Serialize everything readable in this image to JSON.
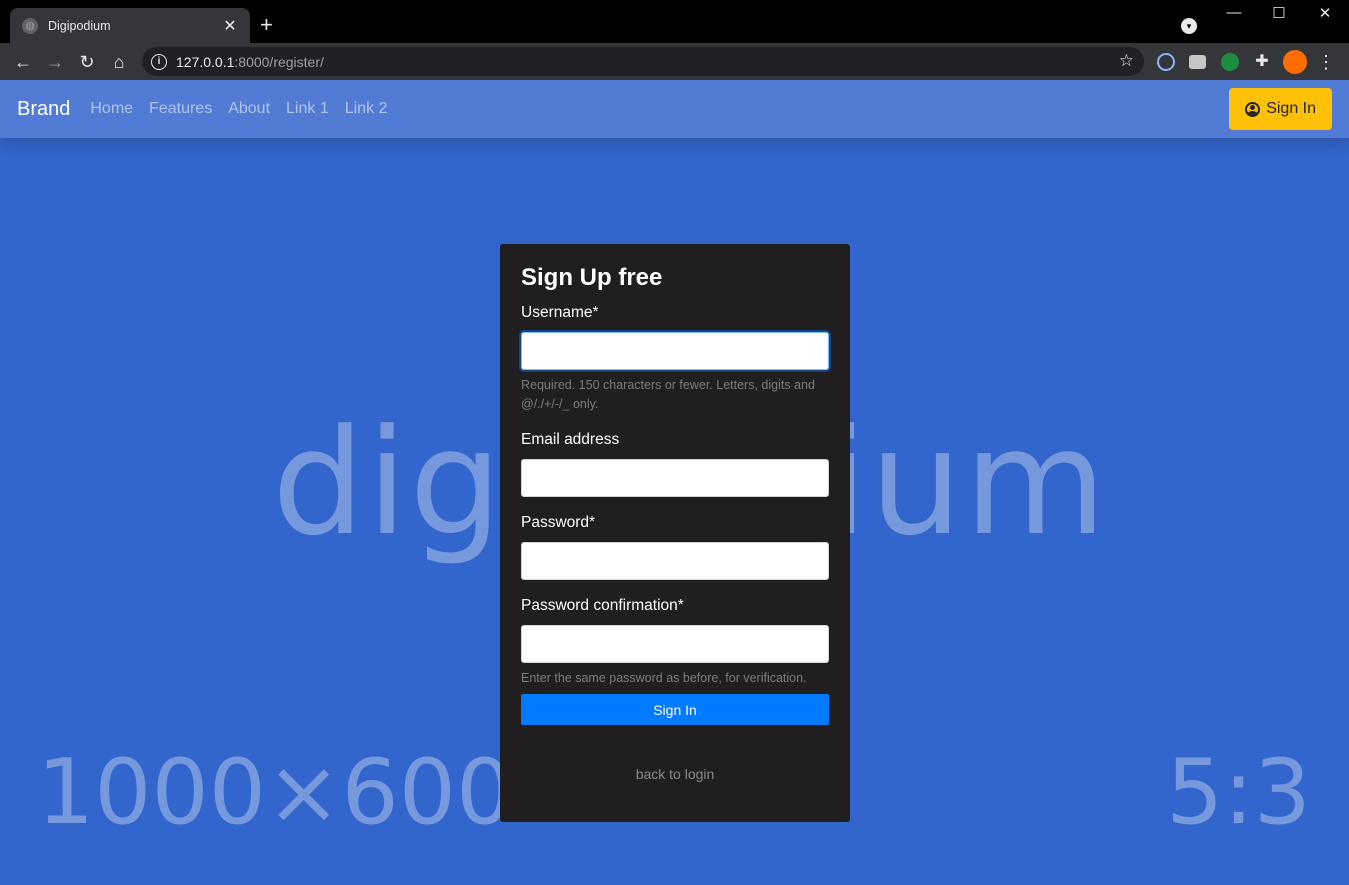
{
  "browser": {
    "tab_title": "Digipodium",
    "url_host": "127.0.0.1",
    "url_rest": ":8000/register/",
    "window_controls": {
      "minimize": "—",
      "maximize": "☐",
      "close": "✕"
    }
  },
  "navbar": {
    "brand": "Brand",
    "links": [
      "Home",
      "Features",
      "About",
      "Link 1",
      "Link 2"
    ],
    "signin_label": "Sign In",
    "signin_color": "#ffc107"
  },
  "background": {
    "watermark_main": "digipodium",
    "watermark_size": "1000×600",
    "watermark_ratio": "5:3",
    "color": "#3366cc"
  },
  "form": {
    "title": "Sign Up free",
    "username_label": "Username*",
    "username_value": "",
    "username_help": "Required. 150 characters or fewer. Letters, digits and @/./+/-/_ only.",
    "email_label": "Email address",
    "email_value": "",
    "password_label": "Password*",
    "password_value": "",
    "password2_label": "Password confirmation*",
    "password2_value": "",
    "password2_help": "Enter the same password as before, for verification.",
    "submit_label": "Sign In",
    "submit_color": "#007bff",
    "back_link": "back to login"
  },
  "icons": [
    "globe-icon",
    "close-icon",
    "plus-icon",
    "back-icon",
    "forward-icon",
    "reload-icon",
    "home-icon",
    "info-icon",
    "star-icon",
    "extension-icon",
    "camera-icon",
    "puzzle-icon",
    "menu-icon",
    "user-circle-icon"
  ]
}
